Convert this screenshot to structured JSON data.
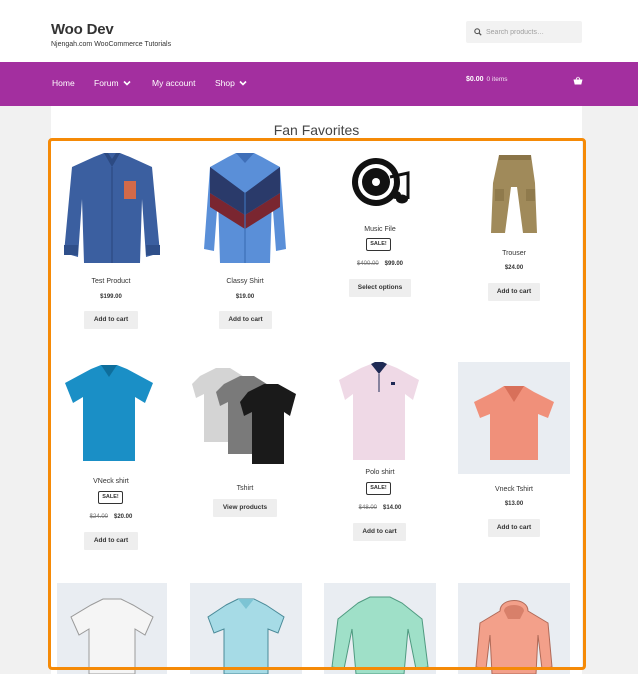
{
  "header": {
    "site_title": "Woo Dev",
    "site_description": "Njengah.com WooCommerce Tutorials",
    "search_placeholder": "Search products…"
  },
  "nav": {
    "items": [
      {
        "label": "Home",
        "has_dropdown": false
      },
      {
        "label": "Forum",
        "has_dropdown": true
      },
      {
        "label": "My account",
        "has_dropdown": false
      },
      {
        "label": "Shop",
        "has_dropdown": true
      }
    ],
    "cart_amount": "$0.00",
    "cart_items": "0 items"
  },
  "section_title": "Fan Favorites",
  "products": [
    {
      "name": "Test Product",
      "price": "$199.00",
      "old_price": "",
      "sale": "",
      "button": "Add to cart"
    },
    {
      "name": "Classy Shirt",
      "price": "$19.00",
      "old_price": "",
      "sale": "",
      "button": "Add to cart"
    },
    {
      "name": "Music File",
      "price": "$99.00",
      "old_price": "$400.00",
      "sale": "SALE!",
      "button": "Select options"
    },
    {
      "name": "Trouser",
      "price": "$24.00",
      "old_price": "",
      "sale": "",
      "button": "Add to cart"
    },
    {
      "name": "VNeck shirt",
      "price": "$20.00",
      "old_price": "$24.00",
      "sale": "SALE!",
      "button": "Add to cart"
    },
    {
      "name": "Tshirt",
      "price": "",
      "old_price": "",
      "sale": "",
      "button": "View products"
    },
    {
      "name": "Polo shirt",
      "price": "$14.00",
      "old_price": "$48.00",
      "sale": "SALE!",
      "button": "Add to cart"
    },
    {
      "name": "Vneck Tshirt",
      "price": "$13.00",
      "old_price": "",
      "sale": "",
      "button": "Add to cart"
    }
  ],
  "colors": {
    "nav_bg": "#a32f9f",
    "highlight_border": "#f58a07",
    "page_bg": "#f1f1f1"
  }
}
